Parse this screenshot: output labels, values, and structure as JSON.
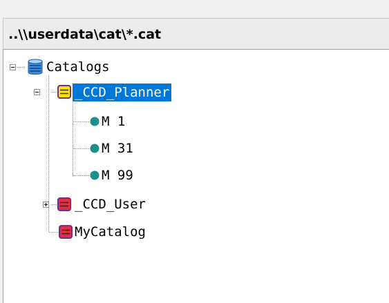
{
  "path_header": {
    "text": "..\\\\userdata\\cat\\*.cat"
  },
  "tree": {
    "root": {
      "label": "Catalogs",
      "icon": "database-icon",
      "expanded": true
    },
    "catalogs": [
      {
        "label": "_CCD_Planner",
        "icon": "catalog-yellow-icon",
        "color": "#f5e600",
        "selected": true,
        "expanded": true,
        "children": [
          {
            "label": "M 1",
            "icon": "object-dot-icon"
          },
          {
            "label": "M 31",
            "icon": "object-dot-icon"
          },
          {
            "label": "M 99",
            "icon": "object-dot-icon"
          }
        ]
      },
      {
        "label": "_CCD_User",
        "icon": "catalog-red-icon",
        "color": "#e03040",
        "selected": false,
        "expanded": false
      },
      {
        "label": "MyCatalog",
        "icon": "catalog-red-icon",
        "color": "#e03040",
        "selected": false,
        "expanded": false
      }
    ]
  },
  "colors": {
    "selection": "#0078d7",
    "object_dot": "#1a9088",
    "catalog_border": "#7a2a8a",
    "database_blue": "#3a8ad8"
  }
}
